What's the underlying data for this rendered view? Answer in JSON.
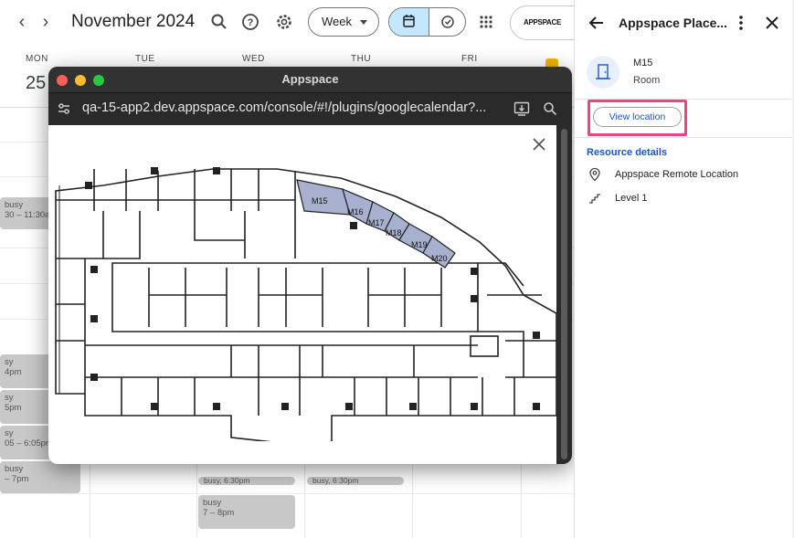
{
  "calendar": {
    "title": "November 2024",
    "view_label": "Week",
    "brand": "APPSPACE",
    "days": [
      {
        "name": "MON",
        "number": "25"
      },
      {
        "name": "TUE"
      },
      {
        "name": "WED"
      },
      {
        "name": "THU"
      },
      {
        "name": "FRI"
      }
    ],
    "events": {
      "mon1_title": "busy",
      "mon1_time": "30 – 11:30a",
      "mon2_title": "sy",
      "mon2_time": "4pm",
      "mon3_title": "sy",
      "mon3_time": "5pm",
      "mon4_title": "sy",
      "mon4_time": "05 – 6:05pm",
      "mon5_title": "busy",
      "mon5_time": "– 7pm",
      "wed_pill": "busy, 6:30pm",
      "thu_pill": "busy, 6:30pm",
      "wed_evt_title": "busy",
      "wed_evt_time": "7 – 8pm"
    }
  },
  "window": {
    "title": "Appspace",
    "url": "qa-15-app2.dev.appspace.com/console/#!/plugins/googlecalendar?...",
    "rooms": [
      "M15",
      "M16",
      "M17",
      "M18",
      "M19",
      "M20"
    ]
  },
  "panel": {
    "title": "Appspace Place...",
    "room_name": "M15",
    "room_type": "Room",
    "view_location": "View location",
    "resource_heading": "Resource details",
    "location": "Appspace Remote Location",
    "level": "Level 1"
  },
  "colors": {
    "accent_blue": "#1a56c4",
    "highlight_pink": "#f2437d",
    "room_fill": "#a7b1cf",
    "event_gray": "#c8c8c8"
  },
  "icons": [
    "chevron-left-icon",
    "chevron-right-icon",
    "search-icon",
    "help-icon",
    "gear-icon",
    "calendar-icon",
    "task-icon",
    "apps-grid-icon",
    "arrow-back-icon",
    "more-vert-icon",
    "close-icon",
    "room-door-icon",
    "location-pin-icon",
    "stairs-icon",
    "site-settings-icon",
    "install-icon",
    "zoom-icon"
  ]
}
